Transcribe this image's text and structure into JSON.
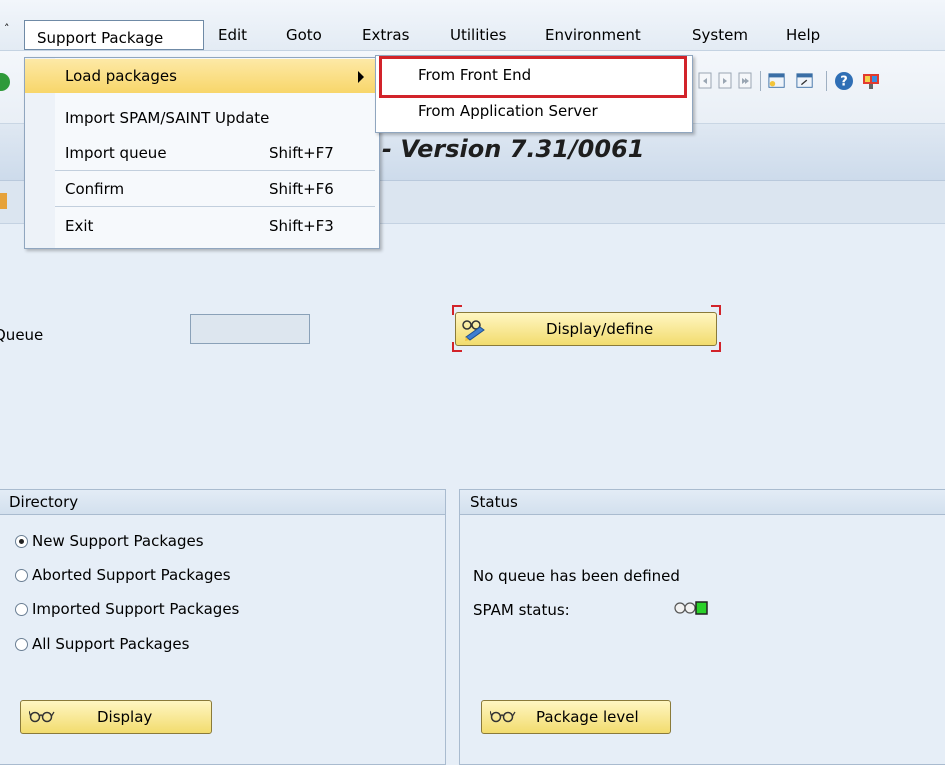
{
  "menubar": {
    "items": [
      {
        "label": "Support Package"
      },
      {
        "label": "Edit"
      },
      {
        "label": "Goto"
      },
      {
        "label": "Extras"
      },
      {
        "label": "Utilities"
      },
      {
        "label": "Environment"
      },
      {
        "label": "System"
      },
      {
        "label": "Help"
      }
    ]
  },
  "dropdown": {
    "items": [
      {
        "label": "Load packages",
        "shortcut": ""
      },
      {
        "label": "Import SPAM/SAINT Update",
        "shortcut": ""
      },
      {
        "label": "Import queue",
        "shortcut": "Shift+F7"
      },
      {
        "label": "Confirm",
        "shortcut": "Shift+F6"
      },
      {
        "label": "Exit",
        "shortcut": "Shift+F3"
      }
    ]
  },
  "submenu": {
    "items": [
      {
        "label": "From Front End"
      },
      {
        "label": "From Application Server"
      }
    ]
  },
  "header": {
    "title": "- Version 7.31/0061"
  },
  "queue": {
    "label": "Queue",
    "value": "",
    "button_label": "Display/define"
  },
  "directory": {
    "title": "Directory",
    "options": [
      {
        "label": "New Support Packages",
        "selected": true
      },
      {
        "label": "Aborted Support Packages",
        "selected": false
      },
      {
        "label": "Imported Support Packages",
        "selected": false
      },
      {
        "label": "All Support Packages",
        "selected": false
      }
    ],
    "button_label": "Display"
  },
  "status": {
    "title": "Status",
    "message": "No queue has been defined",
    "spam_label": "SPAM status:",
    "button_label": "Package level"
  },
  "icons": {
    "glasses": "glasses-icon",
    "pencil_glasses": "display-change-icon",
    "traffic_light": "traffic-light-icon",
    "help": "help-icon"
  },
  "colors": {
    "menu_highlight": "#f8d66a",
    "callout_red": "#d2232a",
    "status_green": "#2bd12b"
  }
}
